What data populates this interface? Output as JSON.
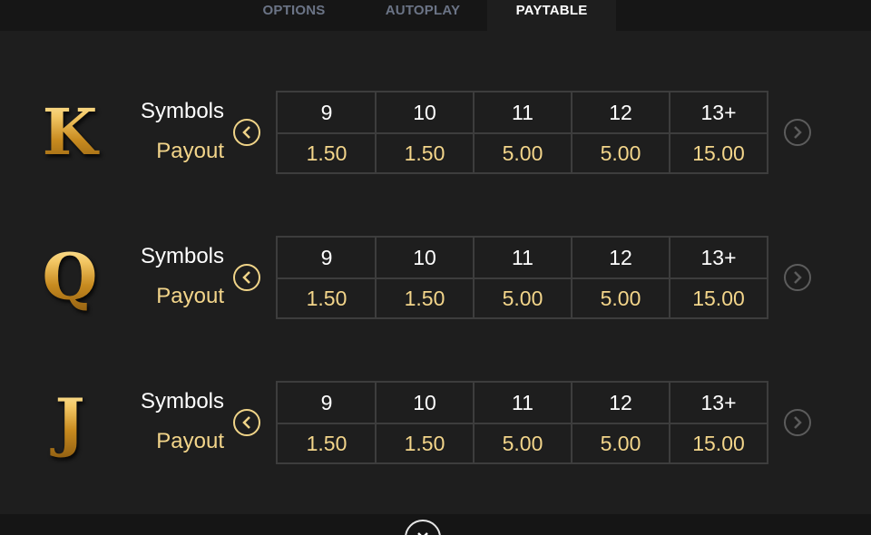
{
  "tabs": [
    {
      "label": "OPTIONS",
      "active": false
    },
    {
      "label": "AUTOPLAY",
      "active": false
    },
    {
      "label": "PAYTABLE",
      "active": true
    }
  ],
  "labels": {
    "symbols": "Symbols",
    "payout": "Payout"
  },
  "colors": {
    "accent_gold": "#f3d58a",
    "inactive_tab": "#6b7486",
    "border": "#3d3d3d"
  },
  "icons": {
    "prev": "chevron-left-circle-icon",
    "next": "chevron-right-circle-icon",
    "close": "close-icon"
  },
  "rows": [
    {
      "symbol": "K",
      "counts": [
        "9",
        "10",
        "11",
        "12",
        "13+"
      ],
      "payouts": [
        "1.50",
        "1.50",
        "5.00",
        "5.00",
        "15.00"
      ]
    },
    {
      "symbol": "Q",
      "counts": [
        "9",
        "10",
        "11",
        "12",
        "13+"
      ],
      "payouts": [
        "1.50",
        "1.50",
        "5.00",
        "5.00",
        "15.00"
      ]
    },
    {
      "symbol": "J",
      "counts": [
        "9",
        "10",
        "11",
        "12",
        "13+"
      ],
      "payouts": [
        "1.50",
        "1.50",
        "5.00",
        "5.00",
        "15.00"
      ]
    }
  ]
}
